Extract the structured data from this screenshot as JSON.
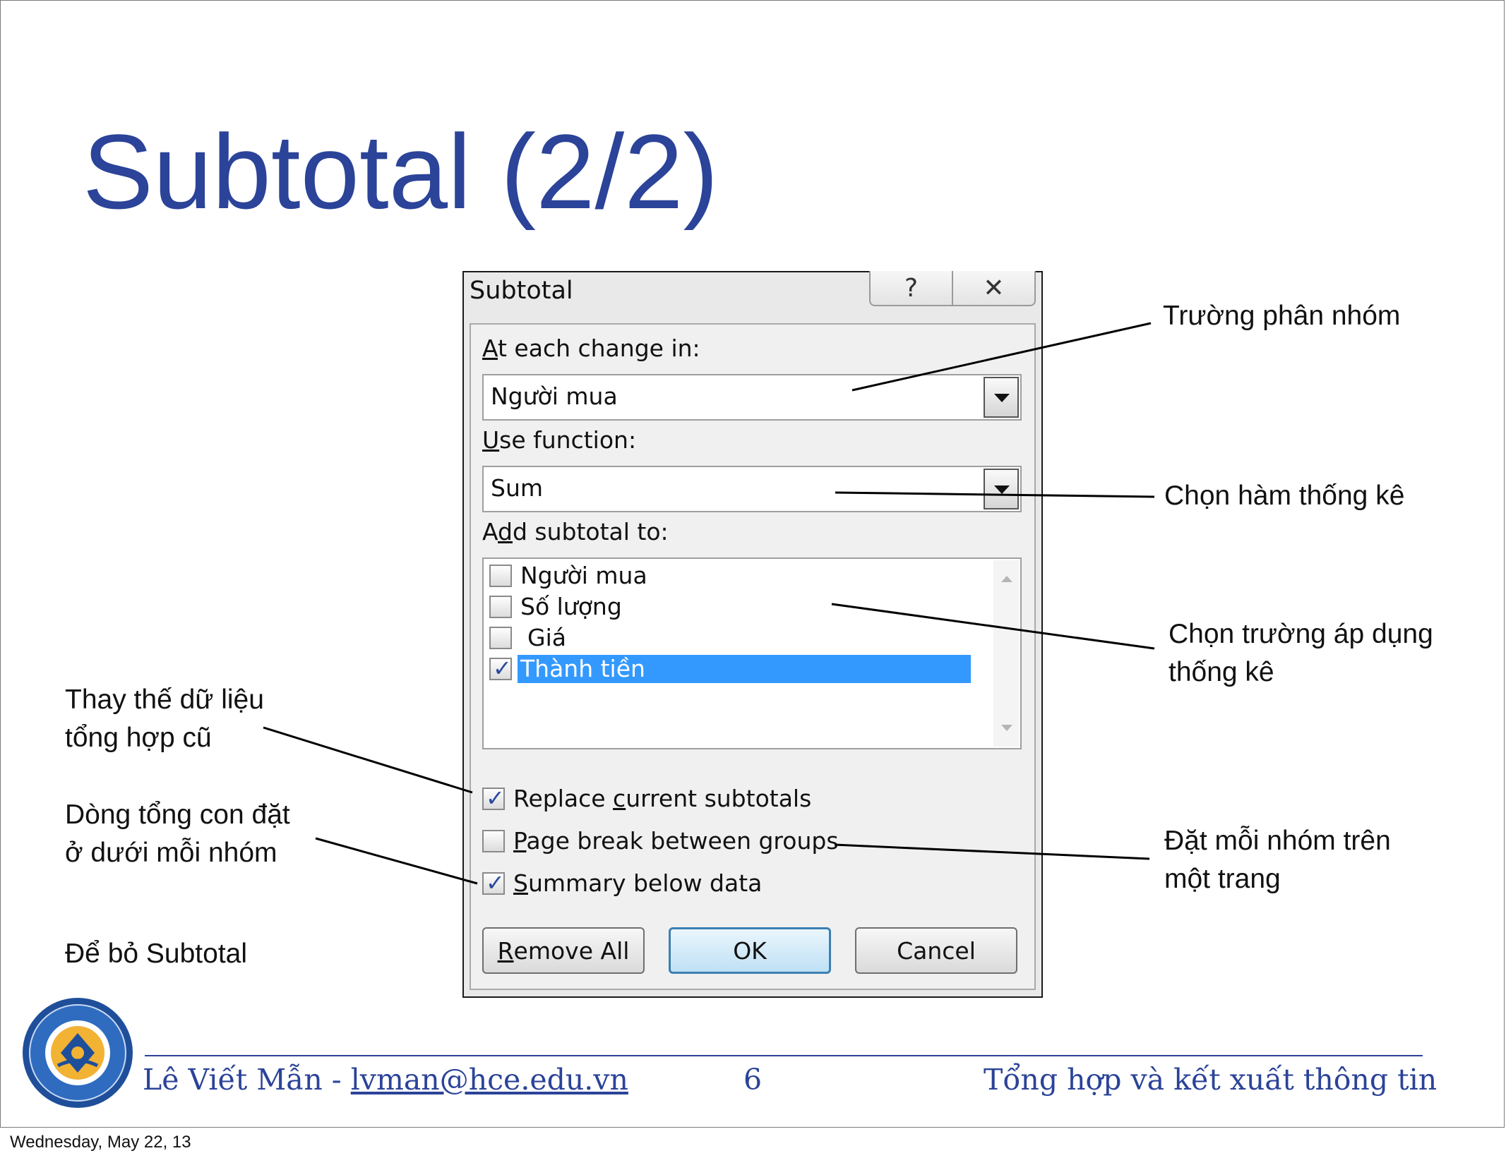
{
  "slide": {
    "title": "Subtotal (2/2)"
  },
  "dialog": {
    "title": "Subtotal",
    "help_glyph": "?",
    "close_glyph": "✕",
    "at_each_change_label_accel": "A",
    "at_each_change_label_rest": "t each change in:",
    "at_each_change_value": "Người mua",
    "use_function_label_accel": "U",
    "use_function_label_rest": "se function:",
    "use_function_value": "Sum",
    "add_subtotal_label_pre": "A",
    "add_subtotal_label_accel": "d",
    "add_subtotal_label_rest": "d subtotal to:",
    "fields": [
      {
        "label": "Người mua",
        "checked": false
      },
      {
        "label": "Số lượng",
        "checked": false
      },
      {
        "label": "Giá",
        "checked": false
      },
      {
        "label": "Thành tiền",
        "checked": true
      }
    ],
    "replace_pre": "Replace ",
    "replace_accel": "c",
    "replace_rest": "urrent subtotals",
    "replace_checked": true,
    "page_break_accel": "P",
    "page_break_rest": "age break between groups",
    "page_break_checked": false,
    "summary_accel": "S",
    "summary_rest": "ummary below data",
    "summary_checked": true,
    "remove_all_accel": "R",
    "remove_all_rest": "emove All",
    "ok_label": "OK",
    "cancel_label": "Cancel"
  },
  "annotations": {
    "group_field": "Trường phân nhóm",
    "function": "Chọn hàm thống kê",
    "apply_line1": "Chọn trường áp dụng",
    "apply_line2": "thống kê",
    "replace_line1": "Thay thế dữ liệu",
    "replace_line2": "tổng hợp cũ",
    "summary_line1": "Dòng tổng con đặt",
    "summary_line2": "ở dưới mỗi nhóm",
    "page_line1": "Đặt mỗi nhóm trên",
    "page_line2": "một trang",
    "remove": "Để bỏ Subtotal"
  },
  "footer": {
    "author": "Lê Viết Mẫn - ",
    "email": "lvman@hce.edu.vn",
    "page_number": "6",
    "course_title": "Tổng hợp và kết xuất thông tin",
    "date": "Wednesday, May 22, 13"
  },
  "colors": {
    "title_blue": "#2b4398",
    "selection_blue": "#3399ff",
    "logo_gold": "#f2b233"
  }
}
